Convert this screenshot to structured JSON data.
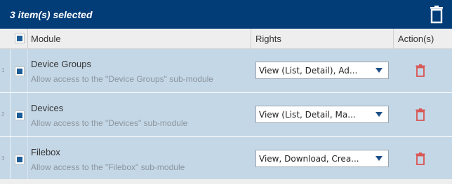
{
  "topbar": {
    "selected_text": "3 item(s) selected",
    "delete_icon": "trash-icon",
    "background": "#033d78"
  },
  "table": {
    "columns": {
      "module": "Module",
      "rights": "Rights",
      "actions": "Action(s)"
    },
    "rows": [
      {
        "num": "1",
        "title": "Device Groups",
        "desc": "Allow access to the \"Device Groups\" sub-module",
        "rights": "View (List, Detail), Ad...",
        "checked": true
      },
      {
        "num": "2",
        "title": "Devices",
        "desc": "Allow access to the \"Devices\" sub-module",
        "rights": "View (List, Detail, Ma...",
        "checked": true
      },
      {
        "num": "3",
        "title": "Filebox",
        "desc": "Allow access to the \"Filebox\" sub-module",
        "rights": "View, Download, Crea...",
        "checked": true
      }
    ]
  },
  "colors": {
    "row_selected": "#c4d7e6",
    "delete_icon": "#d9534f",
    "checkbox": "#1d5c97"
  }
}
